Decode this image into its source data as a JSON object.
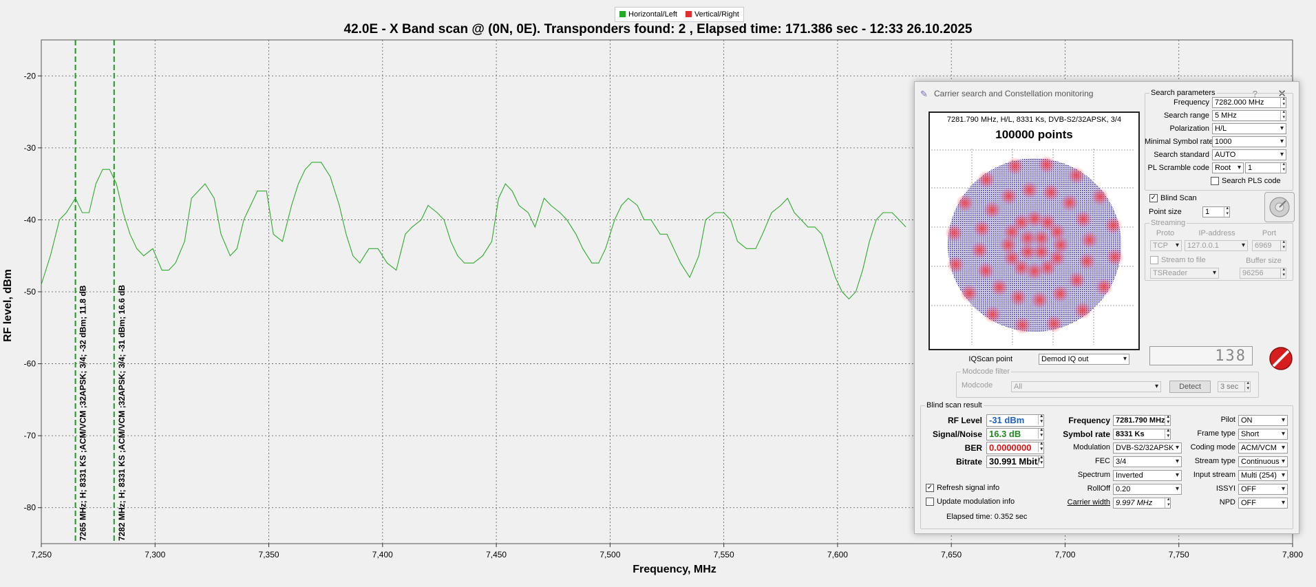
{
  "legend": {
    "items": [
      {
        "label": "Horizontal/Left",
        "color": "#22aa22"
      },
      {
        "label": "Vertical/Right",
        "color": "#e03030"
      }
    ]
  },
  "chart_data": {
    "type": "line",
    "title": "42.0E - X Band  scan @  (0N, 0E). Transponders found: 2 , Elapsed time: 171.386 sec - 12:33 26.10.2025",
    "xlabel": "Frequency, MHz",
    "ylabel": "RF level, dBm",
    "xlim": [
      7250,
      7800
    ],
    "ylim": [
      -85,
      -15
    ],
    "xticks": [
      "7,250",
      "7,300",
      "7,350",
      "7,400",
      "7,450",
      "7,500",
      "7,550",
      "7,600",
      "7,650",
      "7,700",
      "7,750",
      "7,800"
    ],
    "xtick_values": [
      7250,
      7300,
      7350,
      7400,
      7450,
      7500,
      7550,
      7600,
      7650,
      7700,
      7750,
      7800
    ],
    "yticks": [
      "-20",
      "-30",
      "-40",
      "-50",
      "-60",
      "-70",
      "-80"
    ],
    "ytick_values": [
      -20,
      -30,
      -40,
      -50,
      -60,
      -70,
      -80
    ],
    "grid": true,
    "series": [
      {
        "name": "Horizontal/Left",
        "color": "#2eaa2e",
        "x": [
          7250,
          7254,
          7258,
          7261,
          7265,
          7268,
          7271,
          7274,
          7277,
          7280,
          7283,
          7286,
          7289,
          7292,
          7295,
          7299,
          7303,
          7306,
          7309,
          7313,
          7316,
          7319,
          7322,
          7326,
          7329,
          7333,
          7336,
          7339,
          7342,
          7345,
          7349,
          7352,
          7356,
          7360,
          7363,
          7366,
          7369,
          7373,
          7377,
          7381,
          7384,
          7387,
          7390,
          7394,
          7398,
          7402,
          7406,
          7410,
          7413,
          7417,
          7420,
          7424,
          7427,
          7430,
          7433,
          7436,
          7440,
          7444,
          7448,
          7451,
          7454,
          7457,
          7460,
          7464,
          7467,
          7471,
          7474,
          7478,
          7481,
          7485,
          7488,
          7492,
          7495,
          7498,
          7502,
          7505,
          7508,
          7512,
          7515,
          7518,
          7522,
          7525,
          7528,
          7531,
          7535,
          7539,
          7542,
          7546,
          7550,
          7553,
          7556,
          7560,
          7564,
          7567,
          7571,
          7575,
          7578,
          7581,
          7584,
          7587,
          7590,
          7593,
          7596,
          7599,
          7602,
          7605,
          7608,
          7611,
          7614,
          7617,
          7620,
          7624,
          7627,
          7630
        ],
        "y": [
          -49,
          -45,
          -40,
          -39,
          -37,
          -39,
          -39,
          -35,
          -33,
          -33,
          -35,
          -39,
          -42,
          -44,
          -45,
          -44,
          -47,
          -47,
          -46,
          -43,
          -37,
          -36,
          -35,
          -37,
          -42,
          -45,
          -44,
          -40,
          -38,
          -36,
          -36,
          -42,
          -43,
          -38,
          -35,
          -33,
          -32,
          -32,
          -34,
          -38,
          -42,
          -45,
          -46,
          -44,
          -44,
          -46,
          -47,
          -42,
          -41,
          -40,
          -38,
          -39,
          -40,
          -43,
          -45,
          -46,
          -46,
          -45,
          -43,
          -37,
          -35,
          -36,
          -38,
          -39,
          -41,
          -37,
          -38,
          -39,
          -40,
          -42,
          -44,
          -46,
          -46,
          -44,
          -40,
          -38,
          -37,
          -38,
          -40,
          -40,
          -42,
          -42,
          -44,
          -46,
          -48,
          -45,
          -40,
          -39,
          -39,
          -40,
          -43,
          -44,
          -44,
          -42,
          -39,
          -38,
          -37,
          -39,
          -40,
          -41,
          -41,
          -42,
          -45,
          -48,
          -50,
          -51,
          -50,
          -47,
          -43,
          -40,
          -39,
          -39,
          -40,
          -41
        ]
      }
    ],
    "markers": [
      {
        "x": 7265,
        "label": "7265 MHz; H; 8331 KS ;ACM/VCM ;32APSK; 3/4; -32 dBm; 11.8 dB"
      },
      {
        "x": 7282,
        "label": "7282 MHz; H; 8331 KS ;ACM/VCM ;32APSK; 3/4; -31 dBm; 16.6 dB"
      }
    ]
  },
  "status_text": "",
  "dialog": {
    "title": "Carrier search and Constellation monitoring",
    "help": "?",
    "close": "✕",
    "constellation": {
      "header": "7281.790 MHz, H/L, 8331 Ks, DVB-S2/32APSK, 3/4",
      "points_label": "100000 points"
    },
    "search": {
      "group_title": "Search parameters",
      "frequency_label": "Frequency",
      "frequency_value": "7282.000 MHz",
      "range_label": "Search range",
      "range_value": "5 MHz",
      "pol_label": "Polarization",
      "pol_value": "H/L",
      "minsr_label": "Minimal Symbol rate",
      "minsr_value": "1000",
      "std_label": "Search standard",
      "std_value": "AUTO",
      "pls_label": "PL Scramble code",
      "pls_mode": "Root",
      "pls_value": "1",
      "search_pls_label": "Search PLS code"
    },
    "blind_scan_label": "Blind Scan",
    "blind_scan_checked": "✓",
    "point_size_label": "Point size",
    "point_size_value": "1",
    "streaming": {
      "group_title": "Streaming",
      "proto_label": "Proto",
      "proto_value": "TCP",
      "ip_label": "IP-address",
      "ip_value": "127.0.0.1",
      "port_label": "Port",
      "port_value": "6969",
      "stream_file_label": "Stream to file",
      "buffer_label": "Buffer size",
      "reader_value": "TSReader",
      "buffer_value": "96256"
    },
    "iq_label": "IQScan point",
    "iq_value": "Demod IQ out",
    "counter": "138",
    "modcode": {
      "group_title": "Modcode filter",
      "label": "Modcode",
      "value": "All",
      "detect": "Detect",
      "sec": "3 sec"
    },
    "result": {
      "group_title": "Blind scan result",
      "rf_label": "RF Level",
      "rf_value": "-31 dBm",
      "rf_color": "#1f5fbf",
      "sn_label": "Signal/Noise",
      "sn_value": "16.3 dB",
      "sn_color": "#1e8a1e",
      "ber_label": "BER",
      "ber_value": "0.0000000",
      "ber_color": "#e01010",
      "bitrate_label": "Bitrate",
      "bitrate_value": "30.991 Mbit/",
      "freq_label": "Frequency",
      "freq_value": "7281.790 MHz",
      "sr_label": "Symbol rate",
      "sr_value": "8331 Ks",
      "mod_label": "Modulation",
      "mod_value": "DVB-S2/32APSK",
      "fec_label": "FEC",
      "fec_value": "3/4",
      "spectrum_label": "Spectrum",
      "spectrum_value": "Inverted",
      "rolloff_label": "RollOff",
      "rolloff_value": "0.20",
      "cw_label": "Carrier width",
      "cw_value": "9.997 MHz",
      "pilot_label": "Pilot",
      "pilot_value": "ON",
      "frame_label": "Frame type",
      "frame_value": "Short",
      "coding_label": "Coding mode",
      "coding_value": "ACM/VCM",
      "stype_label": "Stream type",
      "stype_value": "Continuous",
      "istream_label": "Input stream",
      "istream_value": "Multi (254)",
      "issyi_label": "ISSYI",
      "issyi_value": "OFF",
      "npd_label": "NPD",
      "npd_value": "OFF",
      "refresh_label": "Refresh signal info",
      "refresh_checked": "✓",
      "update_label": "Update modulation info",
      "elapsed": "Elapsed time: 0.352 sec"
    }
  }
}
